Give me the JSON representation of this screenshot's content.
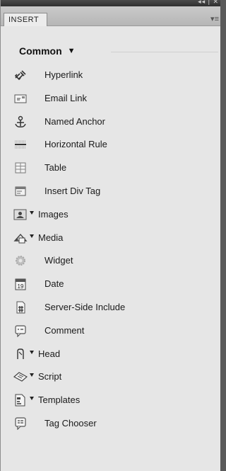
{
  "panel": {
    "tab_label": "INSERT",
    "title_controls": "◂◂ | ✕",
    "menu_glyph": "▾≡"
  },
  "category": {
    "label": "Common",
    "caret": "▼"
  },
  "items": [
    {
      "label": "Hyperlink",
      "icon": "hyperlink-icon",
      "dropdown": false
    },
    {
      "label": "Email Link",
      "icon": "email-link-icon",
      "dropdown": false
    },
    {
      "label": "Named Anchor",
      "icon": "named-anchor-icon",
      "dropdown": false
    },
    {
      "label": "Horizontal Rule",
      "icon": "horizontal-rule-icon",
      "dropdown": false
    },
    {
      "label": "Table",
      "icon": "table-icon",
      "dropdown": false
    },
    {
      "label": "Insert Div Tag",
      "icon": "insert-div-tag-icon",
      "dropdown": false
    },
    {
      "label": "Images",
      "icon": "images-icon",
      "dropdown": true
    },
    {
      "label": "Media",
      "icon": "media-icon",
      "dropdown": true
    },
    {
      "label": "Widget",
      "icon": "widget-icon",
      "dropdown": false
    },
    {
      "label": "Date",
      "icon": "date-icon",
      "dropdown": false,
      "icon_text": "19"
    },
    {
      "label": "Server-Side Include",
      "icon": "server-side-include-icon",
      "dropdown": false
    },
    {
      "label": "Comment",
      "icon": "comment-icon",
      "dropdown": false
    },
    {
      "label": "Head",
      "icon": "head-icon",
      "dropdown": true
    },
    {
      "label": "Script",
      "icon": "script-icon",
      "dropdown": true
    },
    {
      "label": "Templates",
      "icon": "templates-icon",
      "dropdown": true
    },
    {
      "label": "Tag Chooser",
      "icon": "tag-chooser-icon",
      "dropdown": false
    }
  ]
}
